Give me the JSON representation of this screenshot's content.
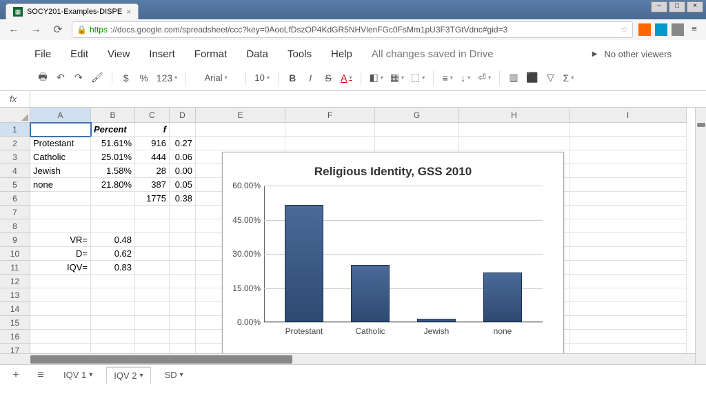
{
  "browser": {
    "tab_title": "SOCY201-Examples-DISPE",
    "url_prefix": "https",
    "url": "://docs.google.com/spreadsheet/ccc?key=0AooLfDszOP4KdGR5NHVlenFGc0FsMm1pU3F3TGtVdnc#gid=3"
  },
  "menu": {
    "file": "File",
    "edit": "Edit",
    "view": "View",
    "insert": "Insert",
    "format": "Format",
    "data": "Data",
    "tools": "Tools",
    "help": "Help",
    "status": "All changes saved in Drive",
    "viewers": "No other viewers"
  },
  "toolbar": {
    "dollar": "$",
    "percent": "%",
    "num": "123",
    "font": "Arial",
    "size": "10",
    "bold": "B",
    "italic": "I",
    "strike": "S",
    "underlineA": "A",
    "sigma": "Σ"
  },
  "formula": {
    "fx": "fx",
    "value": ""
  },
  "columns": [
    "A",
    "B",
    "C",
    "D",
    "E",
    "F",
    "G",
    "H",
    "I"
  ],
  "rows": {
    "1": {
      "B": "Percent",
      "C": "f"
    },
    "2": {
      "A": "Protestant",
      "B": "51.61%",
      "C": "916",
      "D": "0.27"
    },
    "3": {
      "A": "Catholic",
      "B": "25.01%",
      "C": "444",
      "D": "0.06"
    },
    "4": {
      "A": "Jewish",
      "B": "1.58%",
      "C": "28",
      "D": "0.00"
    },
    "5": {
      "A": "none",
      "B": "21.80%",
      "C": "387",
      "D": "0.05"
    },
    "6": {
      "C": "1775",
      "D": "0.38"
    },
    "9": {
      "A": "VR=",
      "B": "0.48"
    },
    "10": {
      "A": "D=",
      "B": "0.62"
    },
    "11": {
      "A": "IQV=",
      "B": "0.83"
    }
  },
  "chart_data": {
    "type": "bar",
    "title": "Religious Identity, GSS 2010",
    "categories": [
      "Protestant",
      "Catholic",
      "Jewish",
      "none"
    ],
    "values": [
      51.61,
      25.01,
      1.58,
      21.8
    ],
    "ylabel_format": "percent",
    "ylim": [
      0,
      60
    ],
    "yticks": [
      0,
      15,
      30,
      45,
      60
    ],
    "ytick_labels": [
      "0.00%",
      "15.00%",
      "30.00%",
      "45.00%",
      "60.00%"
    ]
  },
  "sheets": {
    "tab1": "IQV 1",
    "tab2": "IQV 2",
    "tab3": "SD"
  }
}
